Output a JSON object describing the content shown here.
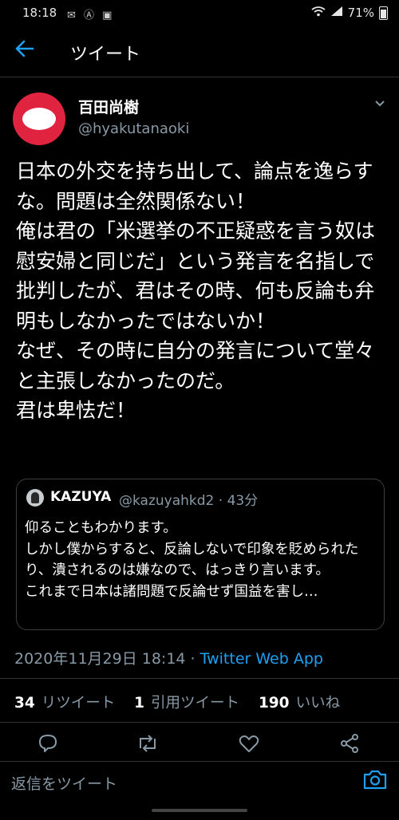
{
  "status_bar": {
    "time": "18:18",
    "battery": "71%"
  },
  "header": {
    "title": "ツイート"
  },
  "author": {
    "name": "百田尚樹",
    "handle": "@hyakutanaoki"
  },
  "tweet": {
    "text": "日本の外交を持ち出して、論点を逸らすな。問題は全然関係ない！\n俺は君の「米選挙の不正疑惑を言う奴は慰安婦と同じだ」という発言を名指しで批判したが、君はその時、何も反論も弁明もしなかったではないか！\nなぜ、その時に自分の発言について堂々と主張しなかったのだ。\n君は卑怯だ！",
    "timestamp": "2020年11月29日 18:14",
    "separator": " · ",
    "source": "Twitter Web App"
  },
  "quoted": {
    "name": "KAZUYA",
    "handle": "@kazuyahkd2 · 43分",
    "text": "仰ることもわかります。\nしかし僕からすると、反論しないで印象を貶められたり、潰されるのは嫌なので、はっきり言います。\nこれまで日本は諸問題で反論せず国益を害し…"
  },
  "stats": {
    "retweets_count": "34",
    "retweets_label": "リツイート",
    "quotes_count": "1",
    "quotes_label": "引用ツイート",
    "likes_count": "190",
    "likes_label": "いいね"
  },
  "actions": {
    "icons": [
      "reply-icon",
      "retweet-icon",
      "like-icon",
      "share-icon"
    ]
  },
  "reply": {
    "placeholder": "返信をツイート"
  },
  "colors": {
    "accent": "#1da1f2",
    "background": "#000000",
    "muted": "#8899a6",
    "avatar": "#e0243f"
  }
}
